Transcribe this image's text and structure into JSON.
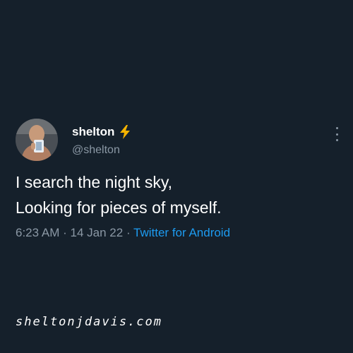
{
  "tweet": {
    "author_name": "shelton",
    "badge_icon": "lightning-bolt-icon",
    "author_handle": "@shelton",
    "text_lines": [
      "I search the night sky,",
      "Looking for pieces of myself."
    ],
    "time": "6:23 AM",
    "separator": "·",
    "date": "14 Jan 22",
    "source": "Twitter for Android",
    "more_icon": "more-options-icon"
  },
  "watermark": "sheltonjdavis.com",
  "colors": {
    "background": "#15202b",
    "text_primary": "#ffffff",
    "text_secondary": "#8b98a5",
    "link": "#1d9bf0",
    "badge": "#f5b301"
  }
}
